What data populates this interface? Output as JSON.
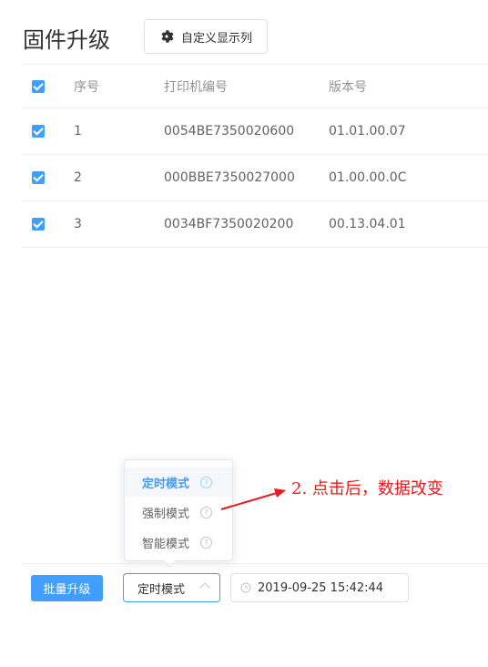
{
  "page": {
    "title": "固件升级"
  },
  "toolbar": {
    "columns_button_label": "自定义显示列",
    "columns_icon": "gear-icon"
  },
  "table": {
    "headers": [
      "序号",
      "打印机编号",
      "版本号"
    ],
    "rows": [
      {
        "index": "1",
        "printer_id": "0054BE7350020600",
        "version": "01.01.00.07",
        "checked": true
      },
      {
        "index": "2",
        "printer_id": "000BBE7350027000",
        "version": "01.00.00.0C",
        "checked": true
      },
      {
        "index": "3",
        "printer_id": "0034BF7350020200",
        "version": "00.13.04.01",
        "checked": true
      }
    ]
  },
  "footer": {
    "batch_button_label": "批量升级",
    "mode_select_value": "定时模式",
    "datetime_value": "2019-09-25 15:42:44"
  },
  "dropdown": {
    "options": [
      "定时模式",
      "强制模式",
      "智能模式"
    ],
    "selected": "定时模式",
    "help_icon": "?"
  },
  "annotation": {
    "text": "2. 点击后，数据改变",
    "color": "#e8191d"
  },
  "colors": {
    "accent": "#409eff",
    "border": "#dcdfe6"
  }
}
